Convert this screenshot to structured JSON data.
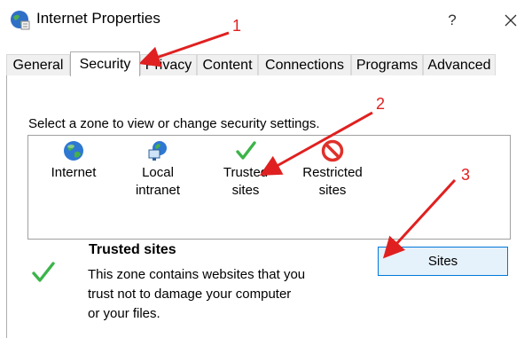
{
  "window": {
    "title": "Internet Properties",
    "help_label": "?"
  },
  "tabs": [
    {
      "label": "General"
    },
    {
      "label": "Security",
      "active": true
    },
    {
      "label": "Privacy"
    },
    {
      "label": "Content"
    },
    {
      "label": "Connections"
    },
    {
      "label": "Programs"
    },
    {
      "label": "Advanced"
    }
  ],
  "security": {
    "prompt": "Select a zone to view or change security settings.",
    "zones": [
      {
        "label": "Internet",
        "icon": "globe-icon"
      },
      {
        "label": "Local\nintranet",
        "icon": "local-intranet-icon"
      },
      {
        "label": "Trusted\nsites",
        "icon": "check-icon",
        "selected": true
      },
      {
        "label": "Restricted\nsites",
        "icon": "restricted-icon"
      }
    ],
    "info": {
      "title": "Trusted sites",
      "description": "This zone contains websites that you\ntrust not to damage your computer\nor your files.",
      "icon": "check-icon"
    },
    "sites_button": "Sites"
  },
  "annotations": [
    {
      "number": "1"
    },
    {
      "number": "2"
    },
    {
      "number": "3"
    }
  ],
  "colors": {
    "annotation": "#e02020",
    "check": "#3cb44a",
    "restricted": "#e0302a",
    "button_border": "#0078d7",
    "button_fill": "#e5f1fb"
  }
}
